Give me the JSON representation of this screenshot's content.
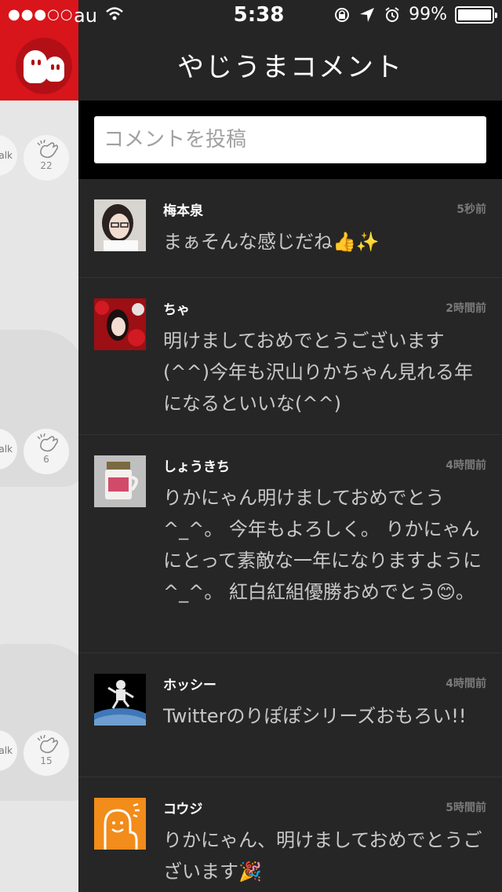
{
  "status_bar": {
    "signal": "●●●○○",
    "carrier": "au",
    "time": "5:38",
    "battery_percent": "99%",
    "battery_level": 0.99
  },
  "header": {
    "title": "やじうまコメント"
  },
  "comment_input": {
    "placeholder": "コメントを投稿"
  },
  "side_counts": [
    {
      "talk_label": "alk",
      "clap_count": "22"
    },
    {
      "talk_label": "alk",
      "clap_count": "6"
    },
    {
      "talk_label": "alk",
      "clap_count": "15"
    }
  ],
  "comments": [
    {
      "author": "梅本泉",
      "time": "5秒前",
      "text": "まぁそんな感じだね👍✨"
    },
    {
      "author": "ちゃ",
      "time": "2時間前",
      "text": "明けましておめでとうございます(^^)今年も沢山りかちゃん見れる年になるといいな(^^)"
    },
    {
      "author": "しょうきち",
      "time": "4時間前",
      "text": "りかにゃん明けましておめでとう^_^。 今年もよろしく。 りかにゃんにとって素敵な一年になりますように^_^。 紅白紅組優勝おめでとう😊。"
    },
    {
      "author": "ホッシー",
      "time": "4時間前",
      "text": "Twitterのりぽぽシリーズおもろい!!"
    },
    {
      "author": "コウジ",
      "time": "5時間前",
      "text": "りかにゃん、明けましておめでとうございます🎉"
    }
  ],
  "colors": {
    "brand_red": "#d7151b",
    "panel_bg": "#262626",
    "avatar_orange": "#f28c1a"
  }
}
